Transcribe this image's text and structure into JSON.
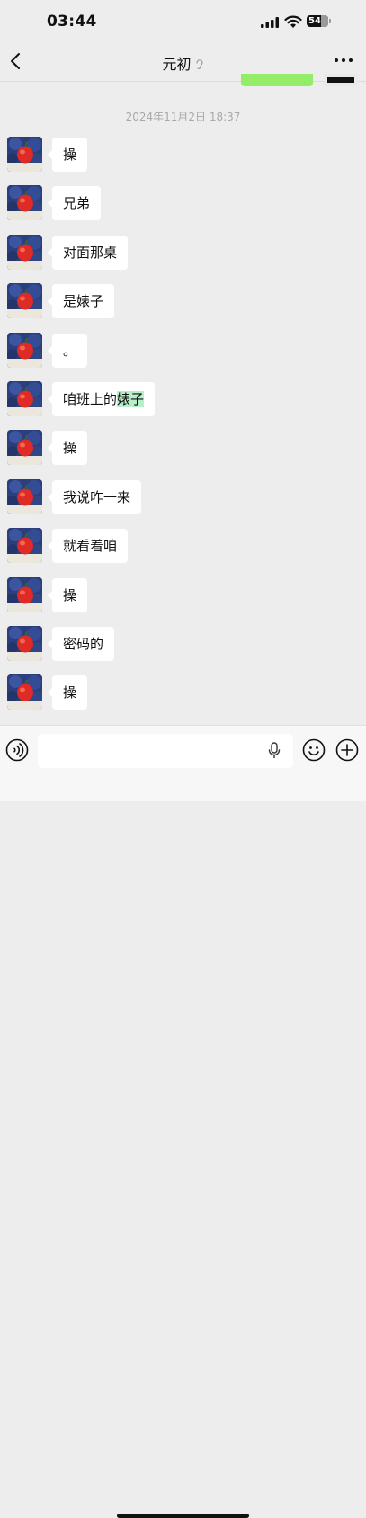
{
  "status_bar": {
    "time": "03:44",
    "battery_level": "54"
  },
  "nav": {
    "title": "元初",
    "back_icon": "chevron-left-icon",
    "more_icon": "ellipsis-icon"
  },
  "timestamp": "2024年11月2日 18:37",
  "messages": [
    {
      "text": "操"
    },
    {
      "text": "兄弟"
    },
    {
      "text": "对面那桌"
    },
    {
      "text": "是婊子"
    },
    {
      "text": "。"
    },
    {
      "text": "咱班上的",
      "highlight": "婊子"
    },
    {
      "text": "操"
    },
    {
      "text": "我说咋一来"
    },
    {
      "text": "就看着咱"
    },
    {
      "text": "操"
    },
    {
      "text": "密码的"
    },
    {
      "text": "操"
    }
  ],
  "input": {
    "value": "",
    "voice_icon": "voice-icon",
    "mic_icon": "mic-icon",
    "emoji_icon": "emoji-icon",
    "plus_icon": "plus-icon"
  },
  "colors": {
    "background": "#ededed",
    "bubble": "#ffffff",
    "sent_bubble": "#95ec69",
    "highlight": "#b6f0c9"
  }
}
